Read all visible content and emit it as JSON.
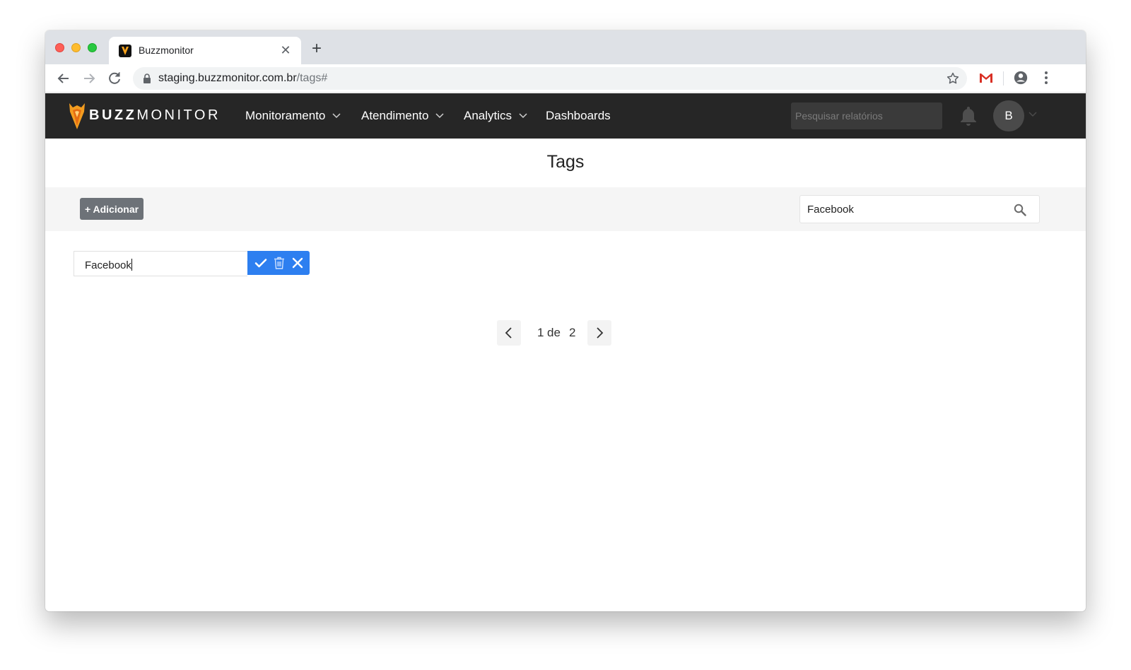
{
  "browser": {
    "tab_title": "Buzzmonitor",
    "url_host": "staging.buzzmonitor.com.br",
    "url_path": "/tags#"
  },
  "navbar": {
    "brand_bold": "BUZZ",
    "brand_light": "MONITOR",
    "menu": [
      {
        "label": "Monitoramento"
      },
      {
        "label": "Atendimento"
      },
      {
        "label": "Analytics"
      },
      {
        "label": "Dashboards"
      }
    ],
    "search_placeholder": "Pesquisar relatórios",
    "avatar_initial": "B"
  },
  "page": {
    "title": "Tags",
    "add_button": "+ Adicionar",
    "search_value": "Facebook",
    "editing_tag": "Facebook"
  },
  "pagination": {
    "current": "1",
    "separator": "de",
    "total": "2"
  }
}
